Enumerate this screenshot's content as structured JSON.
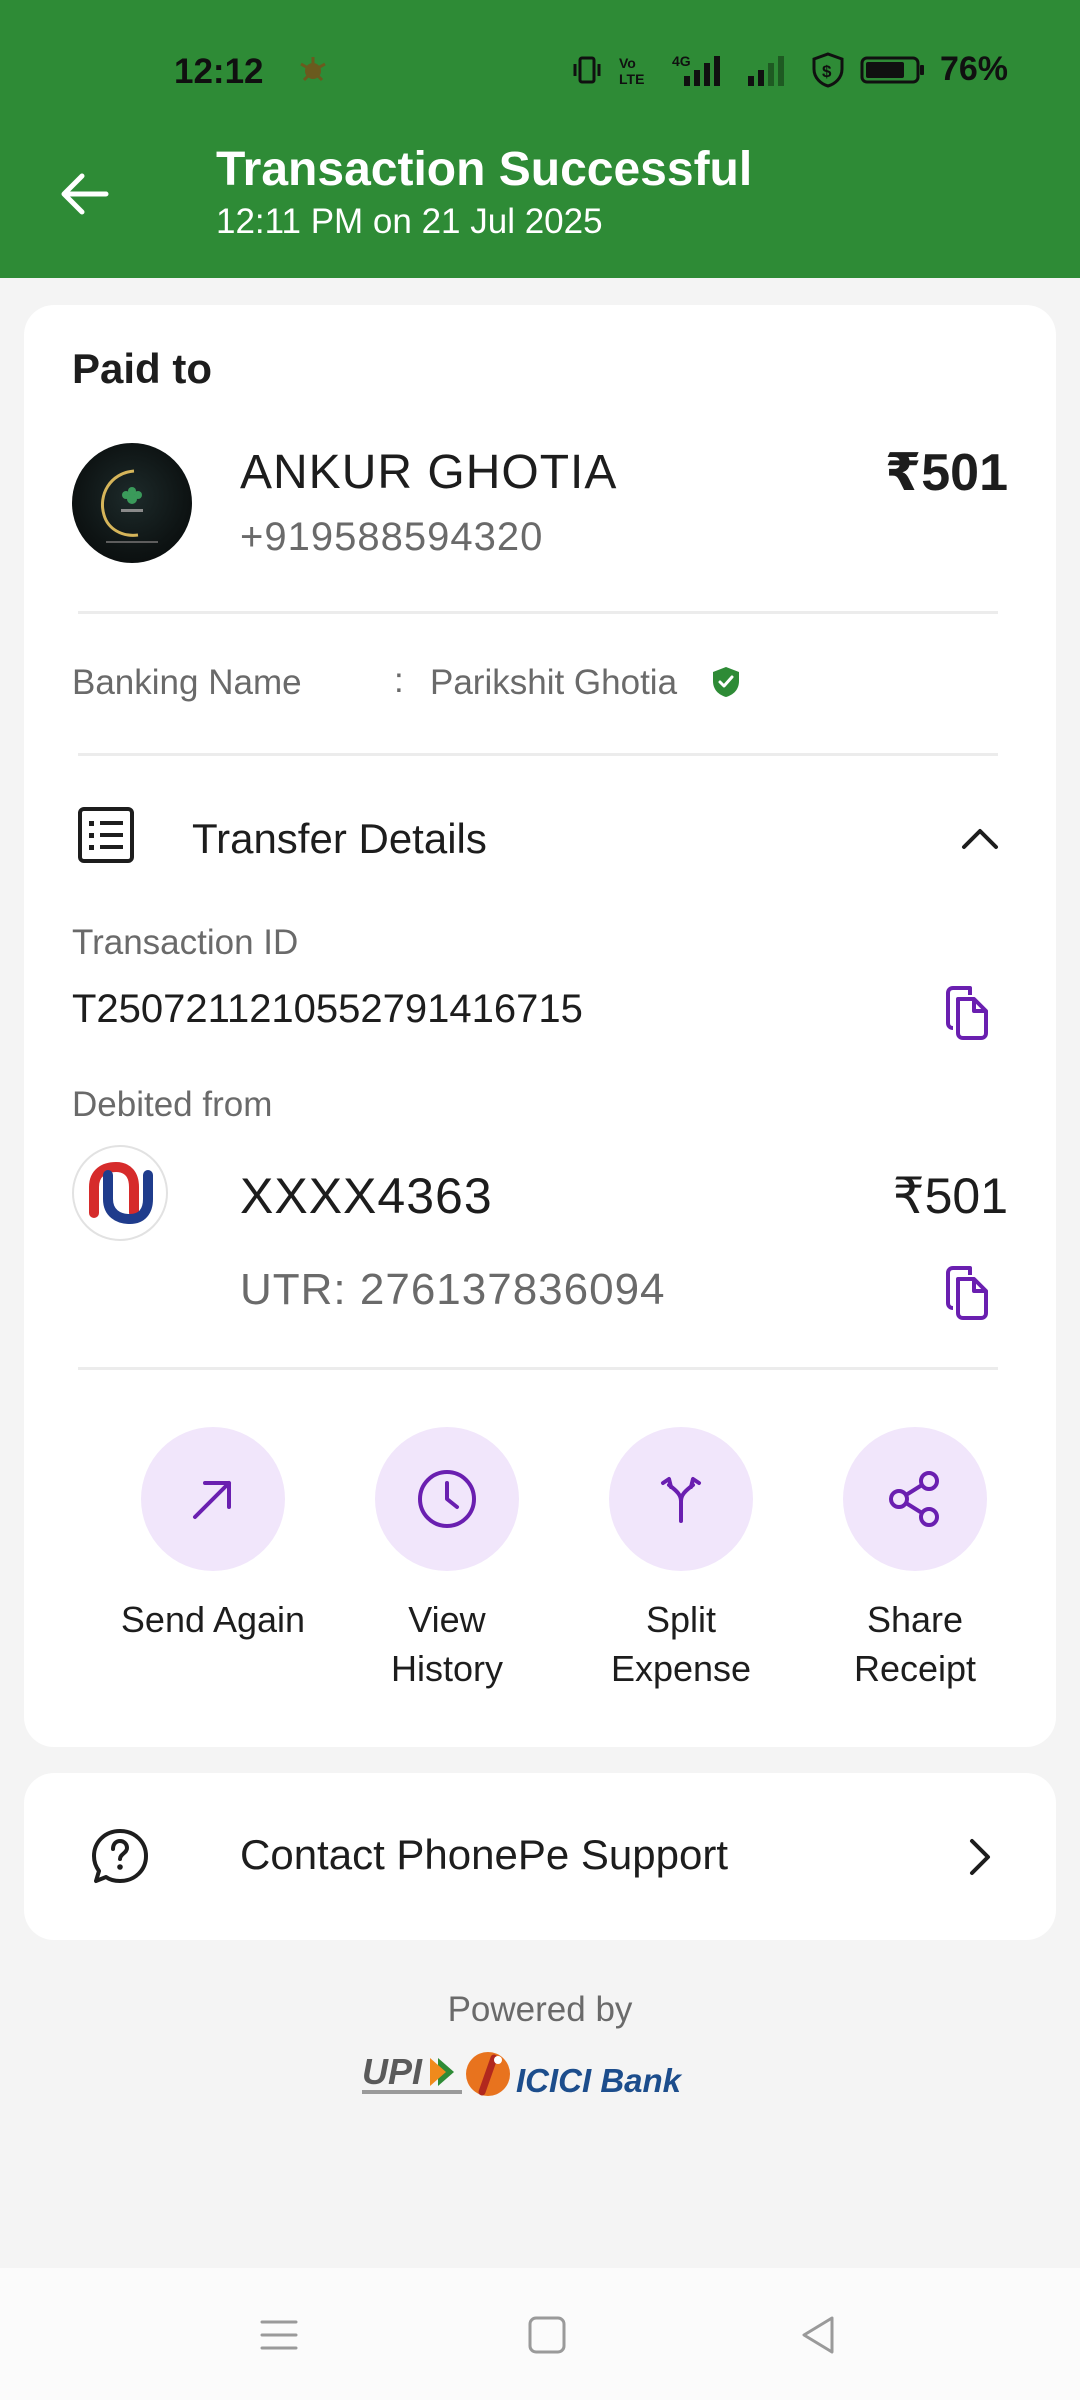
{
  "status_bar": {
    "time": "12:12",
    "battery": "76%",
    "net_label": "4G"
  },
  "header": {
    "title": "Transaction Successful",
    "subtitle": "12:11 PM on 21 Jul 2025"
  },
  "payment": {
    "paid_to_label": "Paid to",
    "payee_name": "ANKUR GHOTIA",
    "payee_phone": "+919588594320",
    "amount": "₹501",
    "banking_name_label": "Banking Name",
    "colon": ":",
    "banking_name": "Parikshit Ghotia"
  },
  "transfer": {
    "section_label": "Transfer Details",
    "txn_id_label": "Transaction ID",
    "txn_id": "T2507211210552791416715",
    "debited_label": "Debited from",
    "account": "XXXX4363",
    "amount": "₹501",
    "utr": "UTR: 276137836094"
  },
  "actions": [
    {
      "line1": "Send Again",
      "line2": ""
    },
    {
      "line1": "View",
      "line2": "History"
    },
    {
      "line1": "Split",
      "line2": "Expense"
    },
    {
      "line1": "Share",
      "line2": "Receipt"
    }
  ],
  "support": {
    "label": "Contact PhonePe Support"
  },
  "footer": {
    "powered_by": "Powered by",
    "upi_text": "UPI",
    "bank_text": "ICICI Bank"
  },
  "colors": {
    "header_green": "#2e8b36",
    "accent_purple": "#6a1fb0",
    "action_bg": "#f1e6fb"
  }
}
